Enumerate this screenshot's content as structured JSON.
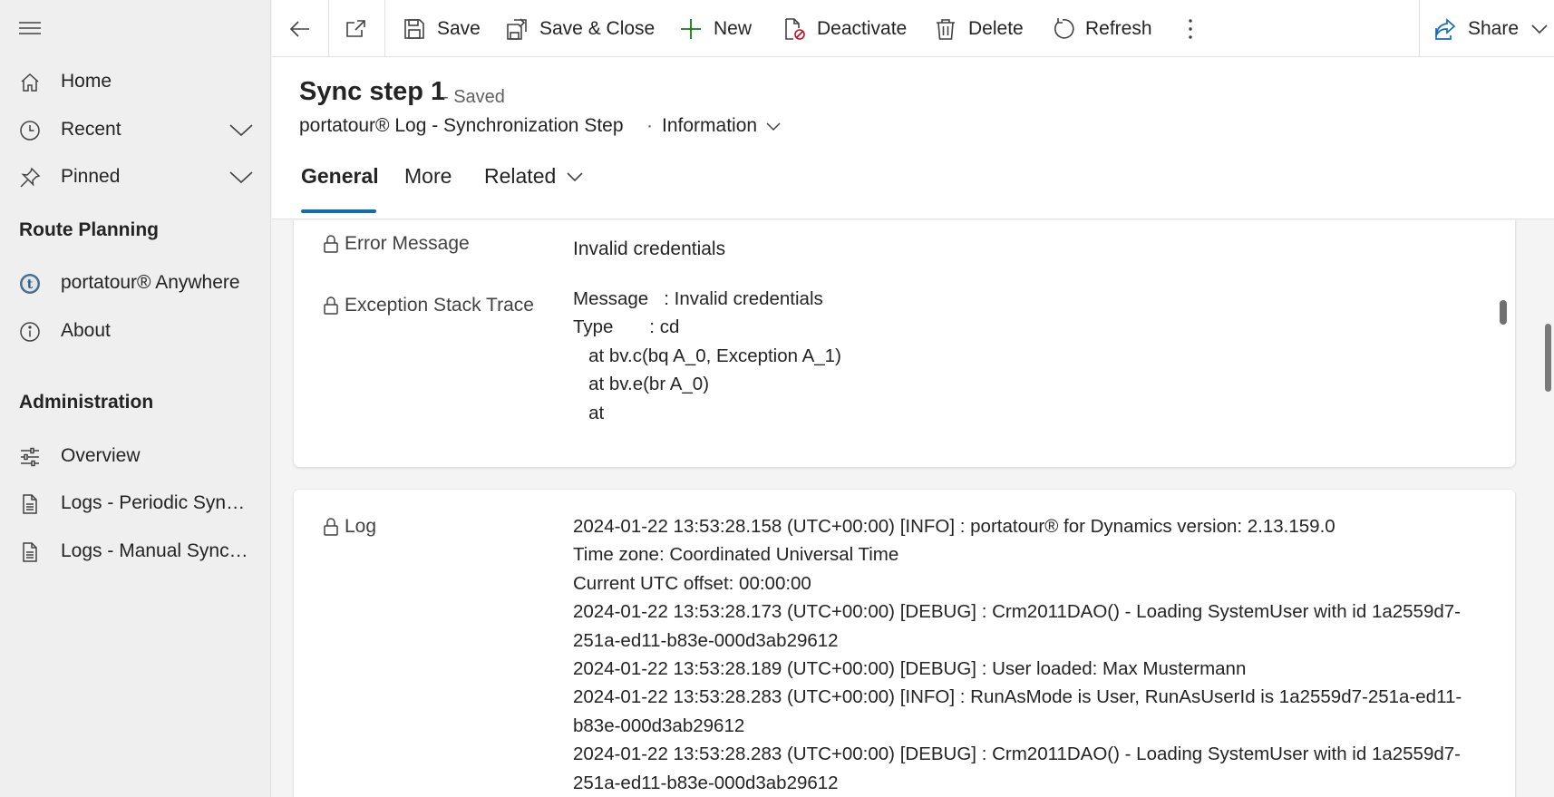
{
  "sidebar": {
    "items": [
      {
        "label": "Home",
        "icon": "home-icon"
      },
      {
        "label": "Recent",
        "icon": "clock-icon",
        "expandable": true
      },
      {
        "label": "Pinned",
        "icon": "pin-icon",
        "expandable": true
      }
    ],
    "sections": [
      {
        "title": "Route Planning",
        "items": [
          {
            "label": "portatour® Anywhere",
            "icon": "portatour-logo-icon"
          },
          {
            "label": "About",
            "icon": "info-icon"
          }
        ]
      },
      {
        "title": "Administration",
        "items": [
          {
            "label": "Overview",
            "icon": "sliders-icon"
          },
          {
            "label": "Logs - Periodic Synchronization",
            "icon": "document-icon"
          },
          {
            "label": "Logs - Manual Synchronization",
            "icon": "document-icon"
          }
        ]
      }
    ]
  },
  "toolbar": {
    "save": "Save",
    "save_close": "Save & Close",
    "new": "New",
    "deactivate": "Deactivate",
    "delete": "Delete",
    "refresh": "Refresh",
    "share": "Share"
  },
  "header": {
    "title": "Sync step 1",
    "status": "- Saved",
    "entity": "portatour® Log - Synchronization Step",
    "separator": "·",
    "form": "Information"
  },
  "tabs": [
    {
      "label": "General",
      "active": true
    },
    {
      "label": "More",
      "active": false
    },
    {
      "label": "Related",
      "active": false
    }
  ],
  "fields": {
    "error_message": {
      "label": "Error Message",
      "value": "Invalid credentials"
    },
    "stack_trace": {
      "label": "Exception Stack Trace",
      "lines": [
        "Message   : Invalid credentials",
        "Type       : cd",
        "   at bv.c(bq A_0, Exception A_1)",
        "   at bv.e(br A_0)",
        "   at"
      ]
    },
    "log": {
      "label": "Log",
      "lines": [
        "2024-01-22 13:53:28.158 (UTC+00:00) [INFO] : portatour® for Dynamics version: 2.13.159.0",
        "Time zone: Coordinated Universal Time",
        "Current UTC offset: 00:00:00",
        "2024-01-22 13:53:28.173 (UTC+00:00) [DEBUG] : Crm2011DAO() - Loading SystemUser with id 1a2559d7-",
        "251a-ed11-b83e-000d3ab29612",
        "2024-01-22 13:53:28.189 (UTC+00:00) [DEBUG] : User loaded: Max Mustermann",
        "2024-01-22 13:53:28.283 (UTC+00:00) [INFO] : RunAsMode is User, RunAsUserId is 1a2559d7-251a-ed11-",
        "b83e-000d3ab29612",
        "2024-01-22 13:53:28.283 (UTC+00:00) [DEBUG] : Crm2011DAO() - Loading SystemUser with id 1a2559d7-",
        "251a-ed11-b83e-000d3ab29612"
      ]
    }
  },
  "colors": {
    "accent": "#0f6cbd",
    "new_icon": "#107c10",
    "deactivate_badge": "#c50f1f"
  }
}
